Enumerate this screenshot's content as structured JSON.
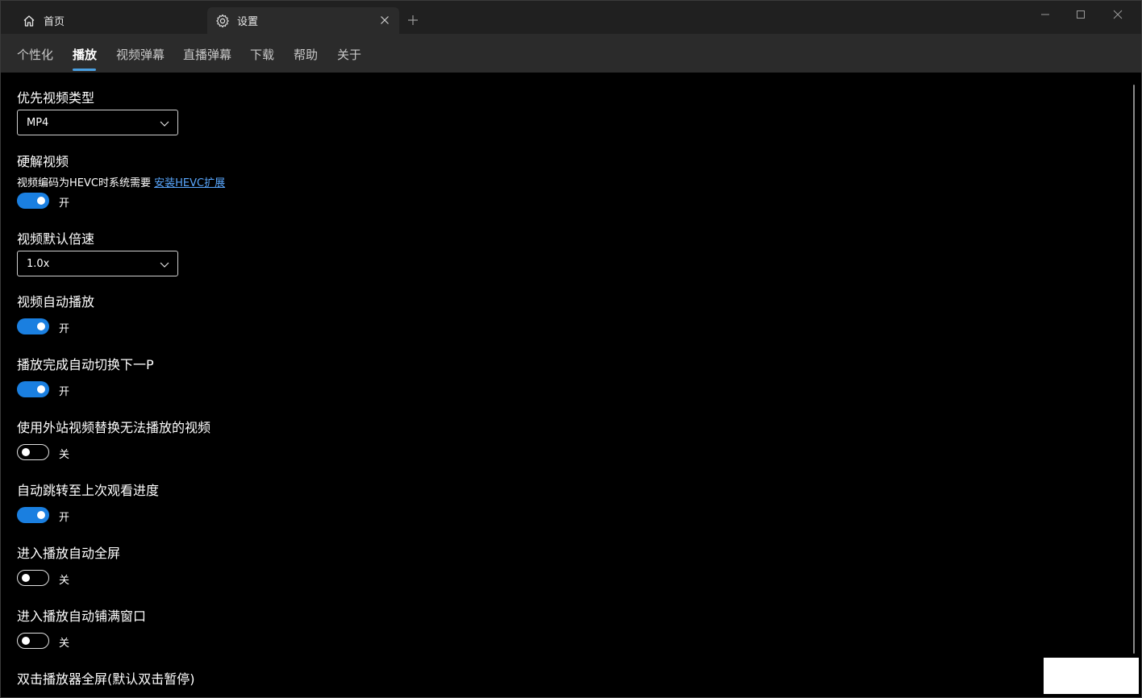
{
  "tabs": {
    "home": {
      "label": "首页",
      "icon": "home-icon"
    },
    "settings": {
      "label": "设置",
      "icon": "gear-icon"
    }
  },
  "pivot": {
    "items": [
      "个性化",
      "播放",
      "视频弹幕",
      "直播弹幕",
      "下载",
      "帮助",
      "关于"
    ],
    "active": "播放"
  },
  "settings": {
    "preferred_type": {
      "title": "优先视频类型",
      "value": "MP4"
    },
    "hw_decode": {
      "title": "硬解视频",
      "desc": "视频编码为HEVC时系统需要",
      "link": "安装HEVC扩展",
      "state": "开"
    },
    "default_speed": {
      "title": "视频默认倍速",
      "value": "1.0x"
    },
    "autoplay": {
      "title": "视频自动播放",
      "state": "开"
    },
    "auto_next": {
      "title": "播放完成自动切换下一P",
      "state": "开"
    },
    "external_replace": {
      "title": "使用外站视频替换无法播放的视频",
      "state": "关"
    },
    "resume_progress": {
      "title": "自动跳转至上次观看进度",
      "state": "开"
    },
    "auto_fullscreen": {
      "title": "进入播放自动全屏",
      "state": "关"
    },
    "auto_fill_window": {
      "title": "进入播放自动铺满窗口",
      "state": "关"
    },
    "double_click_fullscreen": {
      "title": "双击播放器全屏(默认双击暂停)"
    }
  },
  "colors": {
    "accent": "#1a7fe0",
    "link": "#5aa8ff"
  }
}
